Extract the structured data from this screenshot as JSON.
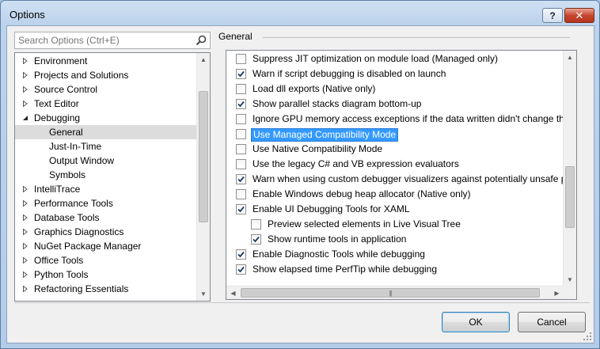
{
  "window": {
    "title": "Options",
    "help_label": "?",
    "close_label": "✕"
  },
  "search": {
    "placeholder": "Search Options (Ctrl+E)"
  },
  "tree": {
    "items": [
      {
        "label": "Environment",
        "expanded": false,
        "level": 0
      },
      {
        "label": "Projects and Solutions",
        "expanded": false,
        "level": 0
      },
      {
        "label": "Source Control",
        "expanded": false,
        "level": 0
      },
      {
        "label": "Text Editor",
        "expanded": false,
        "level": 0
      },
      {
        "label": "Debugging",
        "expanded": true,
        "level": 0
      },
      {
        "label": "General",
        "level": 1,
        "selected": true
      },
      {
        "label": "Just-In-Time",
        "level": 1
      },
      {
        "label": "Output Window",
        "level": 1
      },
      {
        "label": "Symbols",
        "level": 1
      },
      {
        "label": "IntelliTrace",
        "expanded": false,
        "level": 0
      },
      {
        "label": "Performance Tools",
        "expanded": false,
        "level": 0
      },
      {
        "label": "Database Tools",
        "expanded": false,
        "level": 0
      },
      {
        "label": "Graphics Diagnostics",
        "expanded": false,
        "level": 0
      },
      {
        "label": "NuGet Package Manager",
        "expanded": false,
        "level": 0
      },
      {
        "label": "Office Tools",
        "expanded": false,
        "level": 0
      },
      {
        "label": "Python Tools",
        "expanded": false,
        "level": 0
      },
      {
        "label": "Refactoring Essentials",
        "expanded": false,
        "level": 0
      }
    ]
  },
  "section": {
    "title": "General"
  },
  "options": [
    {
      "label": "Suppress JIT optimization on module load (Managed only)",
      "checked": false,
      "level": 0
    },
    {
      "label": "Warn if script debugging is disabled on launch",
      "checked": true,
      "level": 0
    },
    {
      "label": "Load dll exports (Native only)",
      "checked": false,
      "level": 0
    },
    {
      "label": "Show parallel stacks diagram bottom-up",
      "checked": true,
      "level": 0
    },
    {
      "label": "Ignore GPU memory access exceptions if the data written didn't change the v",
      "checked": false,
      "level": 0
    },
    {
      "label": "Use Managed Compatibility Mode",
      "checked": false,
      "level": 0,
      "selected": true
    },
    {
      "label": "Use Native Compatibility Mode",
      "checked": false,
      "level": 0
    },
    {
      "label": "Use the legacy C# and VB expression evaluators",
      "checked": false,
      "level": 0
    },
    {
      "label": "Warn when using custom debugger visualizers against potentially unsafe pro",
      "checked": true,
      "level": 0
    },
    {
      "label": "Enable Windows debug heap allocator (Native only)",
      "checked": false,
      "level": 0
    },
    {
      "label": "Enable UI Debugging Tools for XAML",
      "checked": true,
      "level": 0
    },
    {
      "label": "Preview selected elements in Live Visual Tree",
      "checked": false,
      "level": 1
    },
    {
      "label": "Show runtime tools in application",
      "checked": true,
      "level": 1
    },
    {
      "label": "Enable Diagnostic Tools while debugging",
      "checked": true,
      "level": 0
    },
    {
      "label": "Show elapsed time PerfTip while debugging",
      "checked": true,
      "level": 0
    }
  ],
  "buttons": {
    "ok": "OK",
    "cancel": "Cancel"
  },
  "colors": {
    "selection": "#3399ff",
    "tree_selection": "#dcdcdc"
  }
}
